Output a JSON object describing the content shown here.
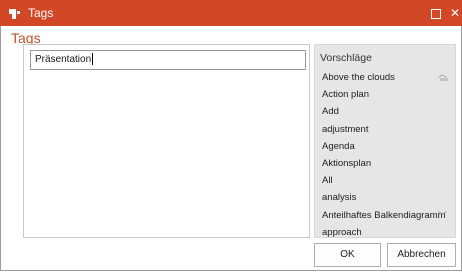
{
  "window": {
    "title": "Tags",
    "maximize_icon": "maximize-icon",
    "close_glyph": "✕",
    "titlebar_color": "#d24726"
  },
  "dialog": {
    "heading": "Tags",
    "heading_color": "#c0502b"
  },
  "input": {
    "value": "Präsentation"
  },
  "suggestions": {
    "title": "Vorschläge",
    "items": [
      "Above the clouds",
      "Action plan",
      "Add",
      "adjustment",
      "Agenda",
      "Aktionsplan",
      "All",
      "analysis",
      "Anteilhaftes Balkendiagramm",
      "approach"
    ],
    "scroll_up": "︿",
    "scroll_down": "﹀"
  },
  "buttons": {
    "ok": "OK",
    "cancel": "Abbrechen"
  }
}
